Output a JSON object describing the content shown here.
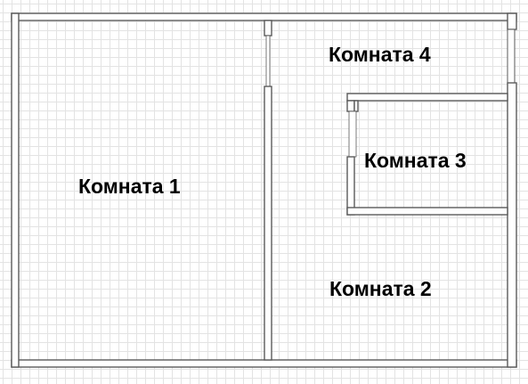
{
  "rooms": [
    {
      "id": "room-1",
      "label": "Комната 1"
    },
    {
      "id": "room-2",
      "label": "Комната 2"
    },
    {
      "id": "room-3",
      "label": "Комната 3"
    },
    {
      "id": "room-4",
      "label": "Комната 4"
    }
  ],
  "colors": {
    "wall_stroke": "#5a5a5a",
    "wall_fill": "#ffffff",
    "grid": "#e3e3e3",
    "text": "#000000"
  }
}
